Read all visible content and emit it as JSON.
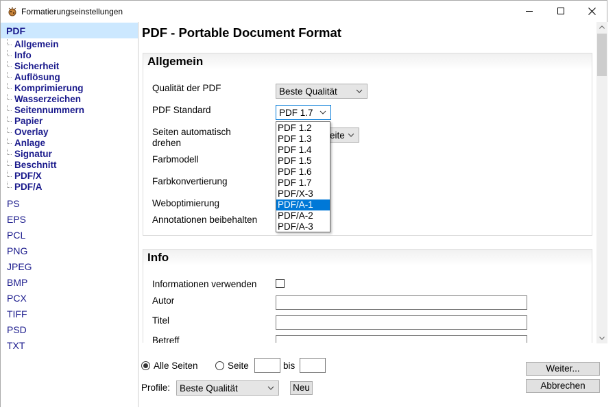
{
  "window": {
    "title": "Formatierungseinstellungen"
  },
  "sidebar": {
    "top": "PDF",
    "subitems": [
      "Allgemein",
      "Info",
      "Sicherheit",
      "Auflösung",
      "Komprimierung",
      "Wasserzeichen",
      "Seitennummern",
      "Papier",
      "Overlay",
      "Anlage",
      "Signatur",
      "Beschnitt",
      "PDF/X",
      "PDF/A"
    ],
    "formats": [
      "PS",
      "EPS",
      "PCL",
      "PNG",
      "JPEG",
      "BMP",
      "PCX",
      "TIFF",
      "PSD",
      "TXT"
    ]
  },
  "content": {
    "title": "PDF - Portable Document Format",
    "allgemein": {
      "heading": "Allgemein",
      "quality_label": "Qualität der PDF",
      "quality_value": "Beste Qualität",
      "standard_label": "PDF Standard",
      "standard_value": "PDF 1.7",
      "rotate_label_1": "Seiten automatisch",
      "rotate_label_2": "drehen",
      "rotate_value_partial": "eite",
      "color_model_label": "Farbmodell",
      "color_conv_label": "Farbkonvertierung",
      "web_opt_label": "Weboptimierung",
      "annotations_label": "Annotationen beibehalten"
    },
    "standard_options": [
      "PDF 1.2",
      "PDF 1.3",
      "PDF 1.4",
      "PDF 1.5",
      "PDF 1.6",
      "PDF 1.7",
      "PDF/X-3",
      "PDF/A-1",
      "PDF/A-2",
      "PDF/A-3"
    ],
    "standard_highlighted": "PDF/A-1",
    "info": {
      "heading": "Info",
      "use_info_label": "Informationen verwenden",
      "author_label": "Autor",
      "title_label": "Titel",
      "subject_label": "Betreff"
    }
  },
  "bottom": {
    "all_pages": "Alle Seiten",
    "page": "Seite",
    "to": "bis",
    "profiles_label": "Profile:",
    "profile_value": "Beste Qualität",
    "new_button": "Neu",
    "next_button": "Weiter...",
    "cancel_button": "Abbrechen"
  }
}
